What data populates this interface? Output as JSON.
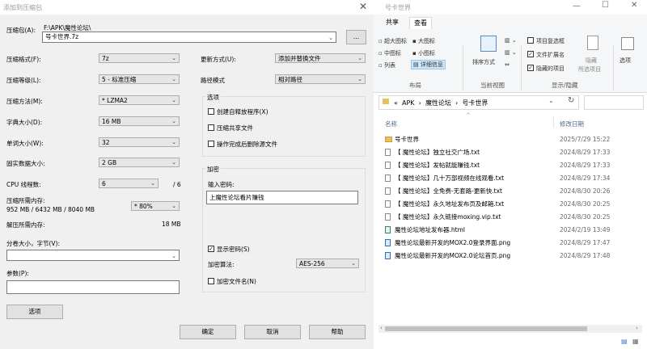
{
  "dialog": {
    "title": "添加到压缩包",
    "archive_label": "压缩包(A):",
    "archive_path": "F:\\APK\\魔性论坛\\",
    "archive_name": "号卡世界.7z",
    "browse_label": "...",
    "format_label": "压缩格式(F):",
    "format_value": "7z",
    "level_label": "压缩等级(L):",
    "level_value": "5 - 标准压缩",
    "method_label": "压缩方法(M):",
    "method_value": "* LZMA2",
    "dict_label": "字典大小(D):",
    "dict_value": "16 MB",
    "word_label": "单词大小(W):",
    "word_value": "32",
    "solid_label": "固实数据大小:",
    "solid_value": "2 GB",
    "threads_label": "CPU 线程数:",
    "threads_value": "6",
    "threads_total": "/ 6",
    "mem_label": "压缩所需内存:",
    "mem_value": "952 MB / 6432 MB / 8040 MB",
    "mem_percent": "* 80%",
    "decomp_label": "解压所需内存:",
    "decomp_value": "18 MB",
    "split_label": "分卷大小，字节(V):",
    "params_label": "参数(P):",
    "update_label": "更新方式(U):",
    "update_value": "添加并替换文件",
    "pathmode_label": "路径模式",
    "pathmode_value": "相对路径",
    "options_title": "选项",
    "opt_sfx": "创建自释放程序(X)",
    "opt_shared": "压缩共享文件",
    "opt_delete": "操作完成后删除源文件",
    "encrypt_title": "加密",
    "password_label": "输入密码:",
    "password_value": "上魔性论坛看片赚钱",
    "show_password": "显示密码(S)",
    "enc_method_label": "加密算法:",
    "enc_method_value": "AES-256",
    "encrypt_names": "加密文件名(N)",
    "options_button": "选项",
    "ok_button": "确定",
    "cancel_button": "取消",
    "help_button": "帮助"
  },
  "explorer": {
    "title": "号卡世界",
    "tabs": [
      "共享",
      "查看"
    ],
    "layout": {
      "xlarge": "超大图标",
      "large": "大图标",
      "medium": "中图标",
      "small": "小图标",
      "list": "列表",
      "details": "详细信息",
      "section": "布局"
    },
    "current_view": {
      "sort": "排序方式",
      "section": "当前视图"
    },
    "show_hide": {
      "checkboxes": "项目复选框",
      "extensions": "文件扩展名",
      "hidden": "隐藏的项目",
      "hide_selected": "隐藏",
      "hide_selected2": "所选项目",
      "section": "显示/隐藏"
    },
    "options": "选项",
    "breadcrumb": [
      "«",
      "APK",
      "›",
      "魔性论坛",
      "›",
      "号卡世界"
    ],
    "col_name": "名称",
    "col_date": "修改日期",
    "files": [
      {
        "name": "号卡世界",
        "date": "2025/7/29 15:22",
        "type": "folder"
      },
      {
        "name": "【 魔性论坛】独立社交广场.txt",
        "date": "2024/8/29 17:33",
        "type": "txt"
      },
      {
        "name": "【 魔性论坛】发帖就能赚钱.txt",
        "date": "2024/8/29 17:33",
        "type": "txt"
      },
      {
        "name": "【 魔性论坛】几十万部视频在线观看.txt",
        "date": "2024/8/29 17:34",
        "type": "txt"
      },
      {
        "name": "【 魔性论坛】全免费-无套路-更新快.txt",
        "date": "2024/8/30 20:26",
        "type": "txt"
      },
      {
        "name": "【 魔性论坛】永久地址发布页及邮箱.txt",
        "date": "2024/8/30 20:25",
        "type": "txt"
      },
      {
        "name": "【 魔性论坛】永久链接moxing.vip.txt",
        "date": "2024/8/30 20:25",
        "type": "txt"
      },
      {
        "name": "魔性论坛地址发布器.html",
        "date": "2024/2/19 13:49",
        "type": "html"
      },
      {
        "name": "魔性论坛最新开发的MOX2.0登录界面.png",
        "date": "2024/8/29 17:47",
        "type": "png"
      },
      {
        "name": "魔性论坛最新开发的MOX2.0论坛首页.png",
        "date": "2024/8/29 17:48",
        "type": "png"
      }
    ]
  }
}
